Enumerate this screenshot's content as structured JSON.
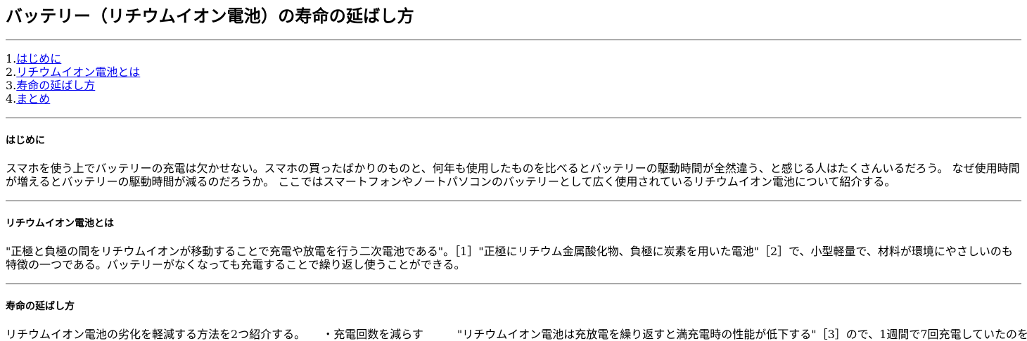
{
  "page_title": "バッテリー（リチウムイオン電池）の寿命の延ばし方",
  "toc": [
    {
      "number": "1.",
      "label": "はじめに"
    },
    {
      "number": "2.",
      "label": "リチウムイオン電池とは"
    },
    {
      "number": "3.",
      "label": "寿命の延ばし方"
    },
    {
      "number": "4.",
      "label": "まとめ"
    }
  ],
  "sections": [
    {
      "heading": "はじめに",
      "body": "スマホを使う上でバッテリーの充電は欠かせない。スマホの買ったばかりのものと、何年も使用したものを比べるとバッテリーの駆動時間が全然違う、と感じる人はたくさんいるだろう。 なぜ使用時間が増えるとバッテリーの駆動時間が減るのだろうか。 ここではスマートフォンやノートパソコンのバッテリーとして広く使用されているリチウムイオン電池について紹介する。"
    },
    {
      "heading": "リチウムイオン電池とは",
      "body": "\"正極と負極の間をリチウムイオンが移動することで充電や放電を行う二次電池である\"。［1］\"正極にリチウム金属酸化物、負極に炭素を用いた電池\"［2］で、小型軽量で、材料が環境にやさしいのも特徴の一つである。バッテリーがなくなっても充電することで繰り返し使うことができる。"
    },
    {
      "heading": "寿命の延ばし方",
      "intro": "リチウムイオン電池の劣化を軽減する方法を2つ紹介する。",
      "bullet": "・充電回数を減らす",
      "detail": "\"リチウムイオン電池は充放電を繰り返すと満充電時の性能が低下する\"［3］ので、1週間で7回充電していたのを"
    }
  ]
}
